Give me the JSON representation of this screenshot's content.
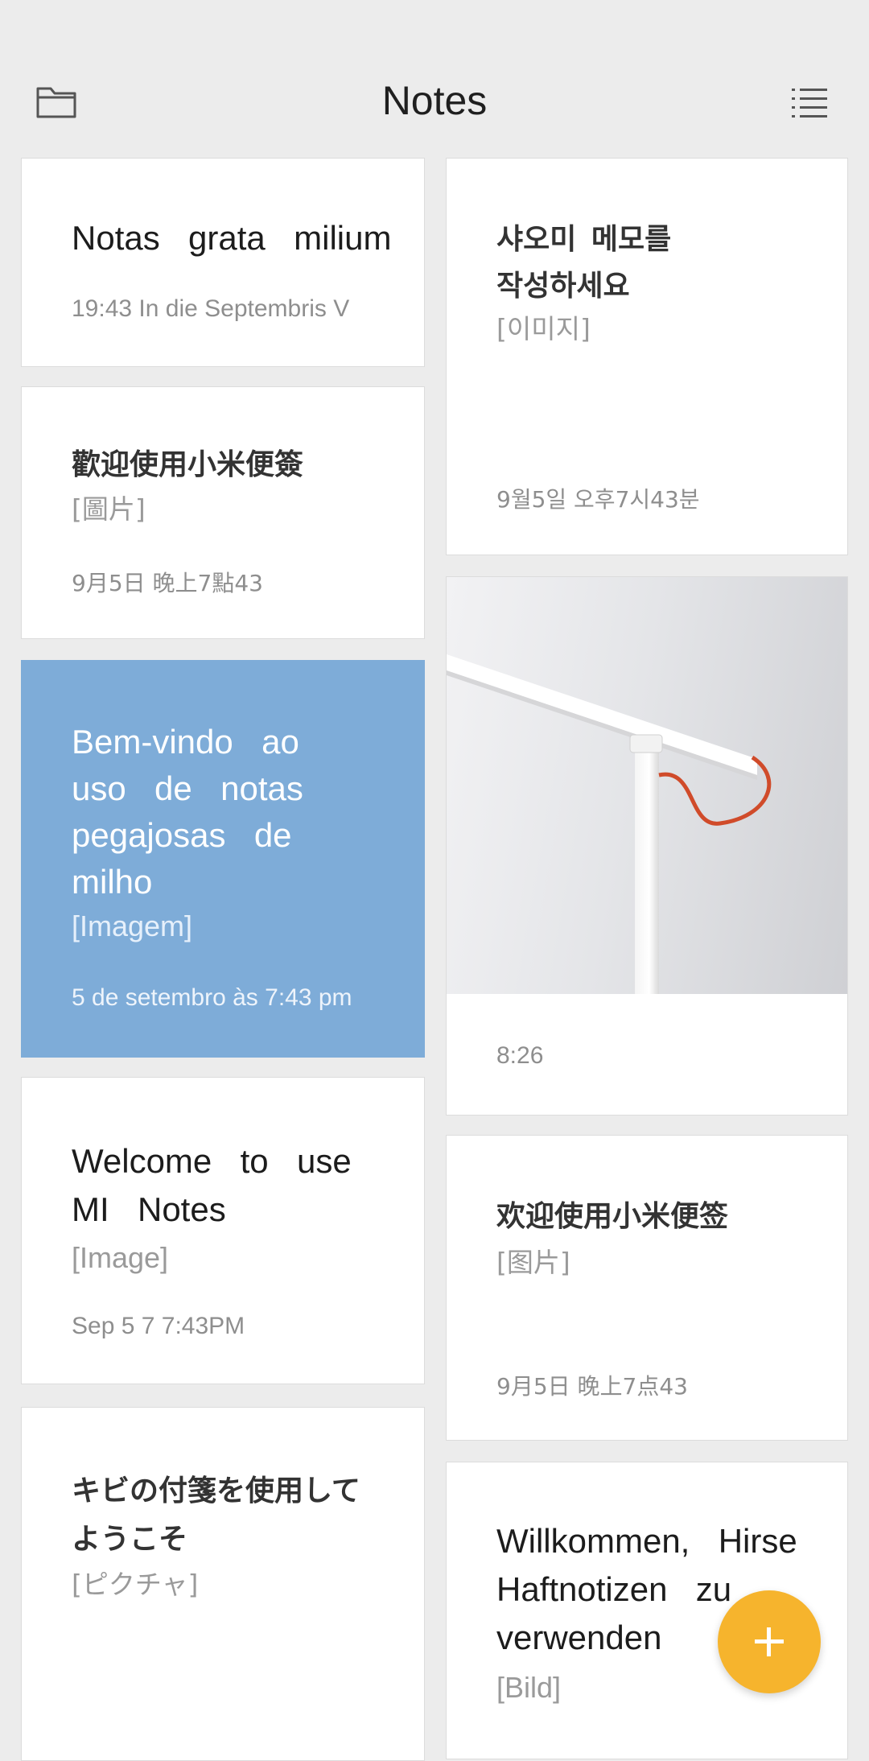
{
  "header": {
    "title": "Notes",
    "left_icon": "folder-icon",
    "right_icon": "list-menu-icon"
  },
  "notes": {
    "n1": {
      "title": "Notas  grata  milium",
      "date": "19:43 In die Septembris V"
    },
    "n2": {
      "title": "샤오미 메모를\n작성하세요",
      "image": "[이미지]",
      "date": "9월5일  오후7시43분"
    },
    "n3": {
      "title": "歡迎使用小米便簽",
      "image": "[圖片]",
      "date": "9月5日 晚上7點43"
    },
    "n4": {
      "title": "Bem-vindo  ao\nuso  de  notas\npegajosas  de\nmilho",
      "image": "[Imagem]",
      "date": "5 de setembro às 7:43 pm",
      "bg_color": "#7eacd8"
    },
    "n5": {
      "image_type": "photo",
      "date": "8:26"
    },
    "n6": {
      "title": "Welcome  to  use\nMI  Notes",
      "image": "[Image]",
      "date": "Sep 5 7 7:43PM"
    },
    "n7": {
      "title": "欢迎使用小米便签",
      "image": "[图片]",
      "date": "9月5日 晚上7点43"
    },
    "n8": {
      "title": "キビの付箋を使用して\nようこそ",
      "image": "[ピクチャ]"
    },
    "n9": {
      "title": "Willkommen,  Hirse\nHaftnotizen  zu\nverwenden",
      "image": "[Bild]"
    }
  },
  "fab": {
    "icon": "plus-icon",
    "color": "#f6b42d"
  }
}
